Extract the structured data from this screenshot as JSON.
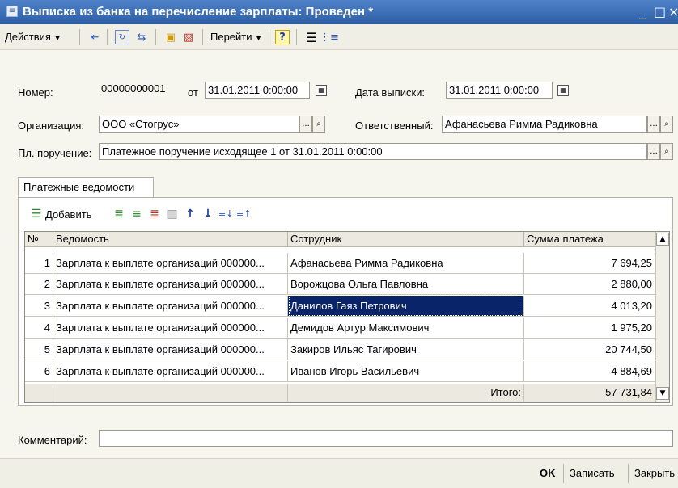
{
  "window": {
    "title": "Выписка из банка на перечисление зарплаты: Проведен *",
    "controls": {
      "minimize": "_",
      "maximize": "□",
      "close": "×"
    }
  },
  "toolbar": {
    "actions_label": "Действия",
    "goto_label": "Перейти",
    "help_label": "?",
    "icons": [
      "arrow-left-icon",
      "refresh-icon",
      "copy-icon",
      "post-icon",
      "unpost-icon",
      "list-icon",
      "structure-icon"
    ]
  },
  "form": {
    "number_label": "Номер:",
    "number_value": "00000000001",
    "from_label": "от",
    "date_value": "31.01.2011  0:00:00",
    "statement_date_label": "Дата выписки:",
    "statement_date_value": "31.01.2011  0:00:00",
    "organization_label": "Организация:",
    "organization_value": "ООО «Стогрус»",
    "responsible_label": "Ответственный:",
    "responsible_value": "Афанасьева Римма Радиковна",
    "payment_order_label": "Пл. поручение:",
    "payment_order_value": "Платежное поручение исходящее 1 от 31.01.2011 0:00:00",
    "comment_label": "Комментарий:",
    "comment_value": ""
  },
  "tabs": [
    {
      "label": "Платежные ведомости"
    }
  ],
  "table_toolbar": {
    "add_label": "Добавить",
    "icons": [
      "add-icon",
      "copy-row-icon",
      "edit-row-icon",
      "delete-row-icon",
      "end-edit-icon",
      "move-up-icon",
      "move-down-icon",
      "sort-asc-icon",
      "sort-desc-icon"
    ]
  },
  "table": {
    "columns": [
      "№",
      "Ведомость",
      "Сотрудник",
      "Сумма платежа"
    ],
    "rows": [
      {
        "n": "1",
        "statement": "Зарплата к выплате организаций 000000...",
        "employee": "Афанасьева Римма Радиковна",
        "amount": "7 694,25"
      },
      {
        "n": "2",
        "statement": "Зарплата к выплате организаций 000000...",
        "employee": "Ворожцова Ольга Павловна",
        "amount": "2 880,00"
      },
      {
        "n": "3",
        "statement": "Зарплата к выплате организаций 000000...",
        "employee": "Данилов Гаяз Петрович",
        "amount": "4 013,20"
      },
      {
        "n": "4",
        "statement": "Зарплата к выплате организаций 000000...",
        "employee": "Демидов Артур Максимович",
        "amount": "1 975,20"
      },
      {
        "n": "5",
        "statement": "Зарплата к выплате организаций 000000...",
        "employee": "Закиров Ильяс Тагирович",
        "amount": "20 744,50"
      },
      {
        "n": "6",
        "statement": "Зарплата к выплате организаций 000000...",
        "employee": "Иванов Игорь Васильевич",
        "amount": "4 884,69"
      }
    ],
    "selected_row": 2,
    "total_label": "Итого:",
    "total_value": "57 731,84"
  },
  "bottom": {
    "ok_label": "OK",
    "save_label": "Записать",
    "close_label": "Закрыть"
  }
}
